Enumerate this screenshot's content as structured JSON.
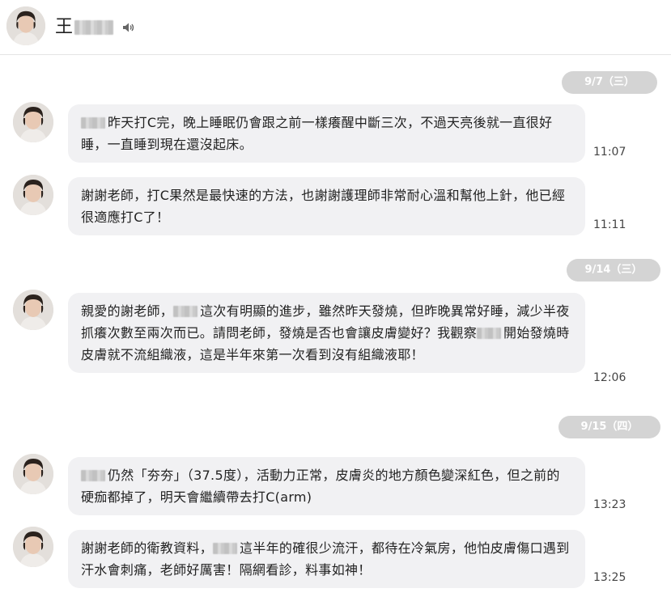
{
  "header": {
    "name_prefix": "王",
    "avatar_icon": "user-avatar-photo",
    "sound_icon": "speaker-icon"
  },
  "date_labels": [
    "9/7（三）",
    "9/14（三）",
    "9/15（四）"
  ],
  "messages": [
    {
      "parts": [
        "",
        "昨天打C完，晚上睡眠仍會跟之前一樣癢醒中斷三次，不過天亮後就一直很好睡，一直睡到現在還沒起床。"
      ],
      "time": "11:07"
    },
    {
      "parts": [
        "謝謝老師，打C果然是最快速的方法，也謝謝護理師非常耐心溫和幫他上針，他已經很適應打C了！"
      ],
      "time": "11:11"
    },
    {
      "parts": [
        "親愛的謝老師，",
        "這次有明顯的進步，雖然昨天發燒，但昨晚異常好睡，減少半夜抓癢次數至兩次而已。請問老師，發燒是否也會讓皮膚變好？我觀察",
        "開始發燒時皮膚就不流組織液，這是半年來第一次看到沒有組織液耶！"
      ],
      "time": "12:06"
    },
    {
      "parts": [
        "",
        "仍然「夯夯」（37.5度），活動力正常，皮膚炎的地方顏色變深紅色，但之前的硬痂都掉了，明天會繼續帶去打C(arm)"
      ],
      "time": "13:23"
    },
    {
      "parts": [
        "謝謝老師的衛教資料，",
        "這半年的確很少流汗，都待在冷氣房，他怕皮膚傷口遇到汗水會刺痛，老師好厲害！隔網看診，料事如神！"
      ],
      "time": "13:25"
    }
  ],
  "colors": {
    "bubble": "#f1f1f3",
    "date_pill": "#d4d4d4",
    "divider": "#e4e4e4"
  }
}
